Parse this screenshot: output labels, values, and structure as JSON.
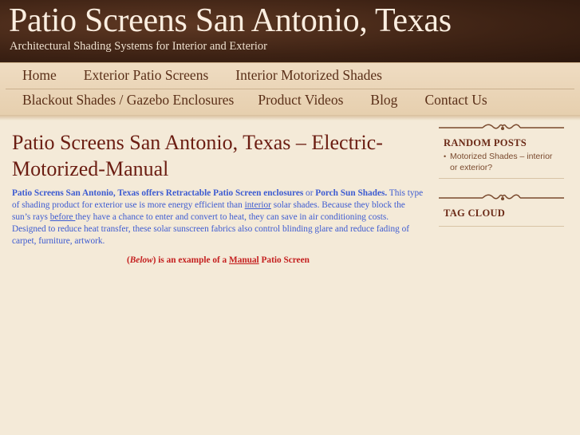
{
  "site": {
    "title": "Patio Screens San Antonio, Texas",
    "description": "Architectural Shading Systems for Interior and Exterior"
  },
  "nav": {
    "row1": [
      "Home",
      "Exterior Patio Screens",
      "Interior Motorized Shades"
    ],
    "row2": [
      "Blackout Shades / Gazebo Enclosures",
      "Product Videos",
      "Blog",
      "Contact Us"
    ]
  },
  "post": {
    "title": "Patio Screens San Antonio, Texas – Electric-Motorized-Manual",
    "intro_bold": "Patio Screens San Antonio, Texas offers Retractable Patio Screen enclosures",
    "or_text": " or ",
    "porch_link": "Porch Sun Shades.",
    "body_1": " This type of shading product for exterior use is more energy efficient than ",
    "interior_link": "interior",
    "body_2": " solar shades. Because they block the sun’s rays ",
    "before_link": "before ",
    "body_3": "they have a chance to enter and convert to heat, they can save in air conditioning costs. Designed to reduce heat transfer, these solar sunscreen fabrics also control blinding glare and reduce fading of carpet, furniture, artwork.",
    "caption_open": "(",
    "caption_below": "Below",
    "caption_mid": ") is an example of a ",
    "caption_manual": "Manual",
    "caption_end": " Patio Screen"
  },
  "sidebar": {
    "random_posts": {
      "title": "RANDOM POSTS",
      "items": [
        "Motorized Shades – interior or exterior?"
      ]
    },
    "tag_cloud": {
      "title": "TAG CLOUD"
    }
  },
  "colors": {
    "header_bg": "#3d2214",
    "nav_bg": "#e6cfae",
    "page_bg": "#f4ead8",
    "title_color": "#6b1d12",
    "link_color": "#3d5bd1",
    "caption_color": "#c41e1e"
  }
}
